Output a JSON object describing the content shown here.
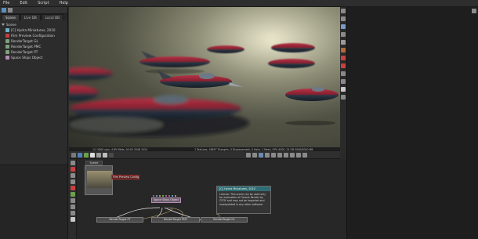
{
  "menu": [
    "File",
    "Edit",
    "Script",
    "Help"
  ],
  "left_panel": {
    "tabs": [
      "Scene",
      "Live DB",
      "Local DB"
    ],
    "tree": [
      {
        "label": "Scene",
        "color": "#d0d0d0",
        "indent": 0
      },
      {
        "label": "[C] Hydra Miniatures, 2010",
        "color": "#6fb0c8",
        "indent": 1
      },
      {
        "label": "Film Preview Configuration",
        "color": "#c04040",
        "indent": 1
      },
      {
        "label": "RenderTarget GL",
        "color": "#7fa07f",
        "indent": 1
      },
      {
        "label": "RenderTarget PMC",
        "color": "#7fa07f",
        "indent": 1
      },
      {
        "label": "RenderTarget PT",
        "color": "#7fa07f",
        "indent": 1
      },
      {
        "label": "Space Ships Object",
        "color": "#b48cb4",
        "indent": 1
      }
    ]
  },
  "render_status": {
    "left": "1/1 2800 s/px, 4.85 Mbits, 00:00 2048 1024",
    "right": "1 Textures, 16857 Triangles, 0 Displacement, 0 Hairs, 1 Mesh, GPU 4000, 24 GB 5000/5000 MB"
  },
  "graph": {
    "scene_tab": "Scene",
    "config_node": "Film Preview Configuration",
    "mesh_node": "Space Ships Object",
    "render_targets": [
      "RenderTarget PT",
      "RenderTarget PMC",
      "RenderTarget GL"
    ],
    "info": {
      "title": "[C] Hydra Miniatures, 2010",
      "body": "License: This scene can be used only for evaluation of Octane Render by OTOY and may not be imported and manipulated in any other software."
    }
  },
  "colors": {
    "accent_red": "#c84040",
    "ship_red": "#a8283a",
    "ship_dark": "#2a3a48",
    "info_header": "#2f6e74"
  }
}
